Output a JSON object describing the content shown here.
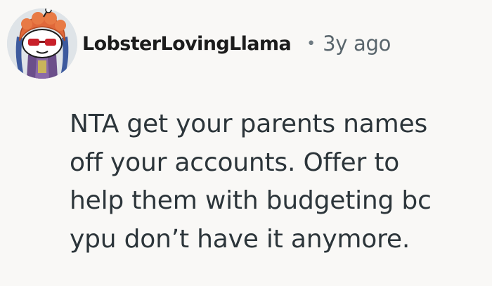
{
  "comment": {
    "author": "LobsterLovingLlama",
    "separator": "•",
    "timestamp": "3y ago",
    "avatar_icon": "snoo-avatar-icon",
    "body_lines": [
      "NTA get your parents names",
      "off your accounts. Offer to",
      "help them with budgeting bc",
      "ypu don’t have it anymore."
    ]
  },
  "colors": {
    "background": "#f9f8f6",
    "username": "#1c1c1c",
    "meta": "#59656c",
    "body": "#2c353a"
  }
}
